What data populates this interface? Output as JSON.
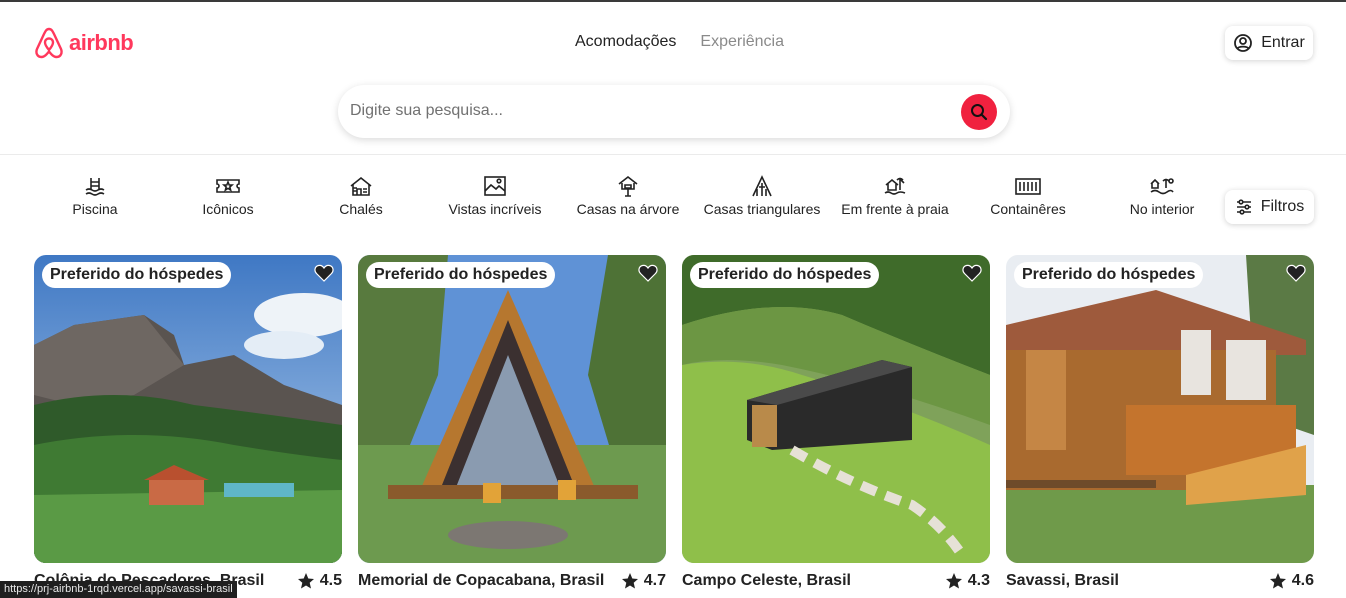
{
  "brand": {
    "name": "airbnb",
    "color": "#ff385c"
  },
  "nav": {
    "tabs": [
      {
        "label": "Acomodações"
      },
      {
        "label": "Experiência"
      }
    ]
  },
  "header": {
    "login_label": "Entrar"
  },
  "search": {
    "placeholder": "Digite sua pesquisa...",
    "value": ""
  },
  "categories": [
    {
      "label": "Piscina",
      "icon": "pool-icon"
    },
    {
      "label": "Icônicos",
      "icon": "ticket-icon"
    },
    {
      "label": "Chalés",
      "icon": "cabin-icon"
    },
    {
      "label": "Vistas incríveis",
      "icon": "landscape-icon"
    },
    {
      "label": "Casas na árvore",
      "icon": "treehouse-icon"
    },
    {
      "label": "Casas triangulares",
      "icon": "a-frame-icon"
    },
    {
      "label": "Em frente à praia",
      "icon": "beachfront-icon"
    },
    {
      "label": "Containêres",
      "icon": "container-icon"
    },
    {
      "label": "No interior",
      "icon": "countryside-icon"
    }
  ],
  "filters": {
    "label": "Filtros"
  },
  "listings": [
    {
      "badge": "Preferido do hóspedes",
      "title": "Colônia do Pescadores, Brasil",
      "rating": "4.5"
    },
    {
      "badge": "Preferido do hóspedes",
      "title": "Memorial de Copacabana, Brasil",
      "rating": "4.7"
    },
    {
      "badge": "Preferido do hóspedes",
      "title": "Campo Celeste, Brasil",
      "rating": "4.3"
    },
    {
      "badge": "Preferido do hóspedes",
      "title": "Savassi, Brasil",
      "rating": "4.6"
    }
  ],
  "status": {
    "url": "https://prj-airbnb-1rqd.vercel.app/savassi-brasil"
  }
}
